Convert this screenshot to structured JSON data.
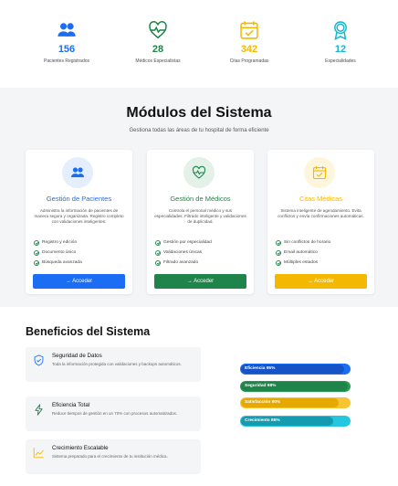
{
  "stats": [
    {
      "icon": "users-icon",
      "value": "156",
      "label": "Pacientes Registrados",
      "color": "#1b6ef3"
    },
    {
      "icon": "heart-pulse-icon",
      "value": "28",
      "label": "Médicos Especialistas",
      "color": "#1e8449"
    },
    {
      "icon": "calendar-check-icon",
      "value": "342",
      "label": "Citas Programadas",
      "color": "#f5b800"
    },
    {
      "icon": "award-icon",
      "value": "12",
      "label": "Especialidades",
      "color": "#17b6cf"
    }
  ],
  "modules": {
    "title": "Módulos del Sistema",
    "subtitle": "Gestiona todas las áreas de tu hospital de forma eficiente",
    "cards": [
      {
        "icon": "users-icon",
        "title": "Gestión de Pacientes",
        "description": "Administra la información de pacientes de manera segura y organizada. Registro completo con validaciones inteligentes.",
        "features": [
          "Registro y edición",
          "Documento único",
          "Búsqueda avanzada"
        ],
        "button": "→ Acceder",
        "color": "#1b6ef3",
        "badge_bg": "#e4eefc"
      },
      {
        "icon": "heart-pulse-icon",
        "title": "Gestión de Médicos",
        "description": "Controla el personal médico y sus especialidades. Filtrado inteligente y validaciones de duplicidad.",
        "features": [
          "Gestión por especialidad",
          "Validaciones únicas",
          "Filtrado avanzado"
        ],
        "button": "→ Acceder",
        "color": "#1e8449",
        "badge_bg": "#e3f1e8"
      },
      {
        "icon": "calendar-check-icon",
        "title": "Citas Médicas",
        "description": "Sistema inteligente de agendamiento. Evita conflictos y envía confirmaciones automáticas.",
        "features": [
          "Sin conflictos de horario",
          "Email automático",
          "Múltiples estados"
        ],
        "button": "→ Acceder",
        "color": "#f5b800",
        "badge_bg": "#fdf6dc"
      }
    ]
  },
  "benefits": {
    "title": "Beneficios del Sistema",
    "items": [
      {
        "icon": "shield-check-icon",
        "title": "Seguridad de Datos",
        "description": "Toda la información protegida con validaciones y backups automáticos.",
        "color": "#1b6ef3"
      },
      {
        "icon": "lightning-icon",
        "title": "Eficiencia Total",
        "description": "Reduce tiempos de gestión en un 70% con procesos automatizados.",
        "color": "#1e8449"
      },
      {
        "icon": "graph-up-icon",
        "title": "Crecimiento Escalable",
        "description": "Sistema preparado para el crecimiento de tu institución médica.",
        "color": "#f5b800"
      }
    ],
    "progress": [
      {
        "label": "Eficiencia 95%",
        "value": 95,
        "track": "#1b6ef3",
        "fill": "#1553c7"
      },
      {
        "label": "Seguridad 98%",
        "value": 98,
        "track": "#2a9a55",
        "fill": "#1e8449"
      },
      {
        "label": "Satisfacción 90%",
        "value": 90,
        "track": "#f7c531",
        "fill": "#e6a900"
      },
      {
        "label": "Crecimiento 85%",
        "value": 85,
        "track": "#25c6e0",
        "fill": "#149bb0"
      }
    ]
  }
}
